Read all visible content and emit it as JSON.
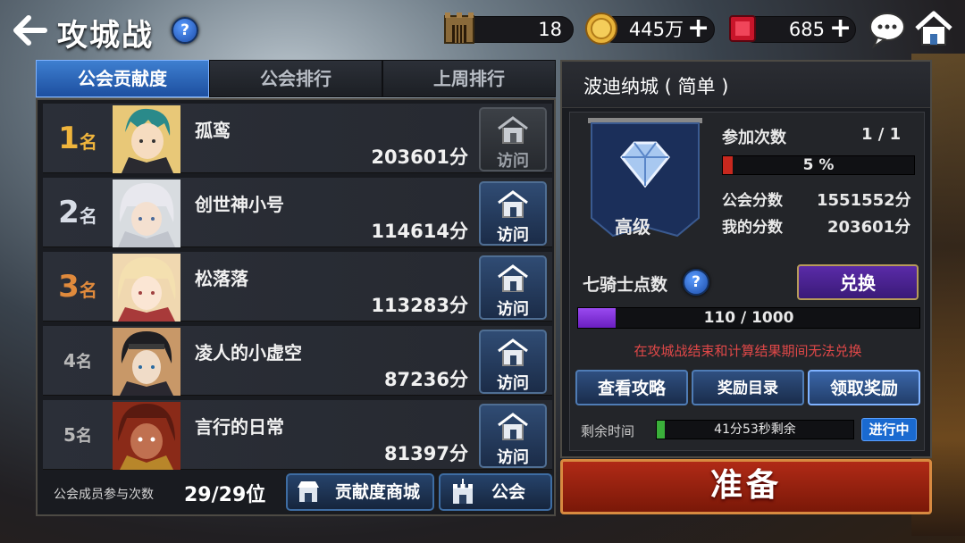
{
  "header": {
    "title": "攻城战",
    "help": "?",
    "castle_count": "18",
    "gold": "445万",
    "gems": "685",
    "plus": "+"
  },
  "tabs": [
    "公会贡献度",
    "公会排行",
    "上周排行"
  ],
  "rankings": [
    {
      "rank": "1",
      "unit": "名",
      "name": "孤鸾",
      "score": "203601分",
      "visit": "访问"
    },
    {
      "rank": "2",
      "unit": "名",
      "name": "创世神小号",
      "score": "114614分",
      "visit": "访问"
    },
    {
      "rank": "3",
      "unit": "名",
      "name": "松落落",
      "score": "113283分",
      "visit": "访问"
    },
    {
      "rank": "4",
      "unit": "名",
      "name": "凌人的小虚空",
      "score": "87236分",
      "visit": "访问"
    },
    {
      "rank": "5",
      "unit": "名",
      "name": "言行的日常",
      "score": "81397分",
      "visit": "访问"
    }
  ],
  "footer": {
    "label": "公会成员参与次数",
    "count": "29/29位",
    "shop_button": "贡献度商城",
    "guild_button": "公会"
  },
  "castle": {
    "name": "波迪纳城 ( 简单 )",
    "level": "高级",
    "participation_label": "参加次数",
    "participation_value": "1 / 1",
    "progress_text": "5  %",
    "progress": 0.05,
    "guild_score_label": "公会分数",
    "guild_score": "1551552分",
    "my_score_label": "我的分数",
    "my_score": "203601分",
    "knight_label": "七骑士点数",
    "knight_help": "?",
    "exchange_button": "兑换",
    "knight_points_text": "110 / 1000",
    "knight_progress": 0.11,
    "notice": "在攻城战结束和计算结果期间无法兑换",
    "guide_button": "查看攻略",
    "rewards_list_button": "奖励目录",
    "claim_button": "领取奖励",
    "remaining_label": "剩余时间",
    "remaining_text": "41分53秒剩余",
    "status": "进行中"
  },
  "prepare_button": "准备",
  "colors": {
    "accent_blue": "#2f6fd0",
    "rank_gold": "#f0b53c",
    "rank_silver": "#d8dde6",
    "rank_bronze": "#e08a3c",
    "rank_plain": "#b8b8b8",
    "progress_red": "#c8281e",
    "knight_purple": "#7b2fd2"
  }
}
